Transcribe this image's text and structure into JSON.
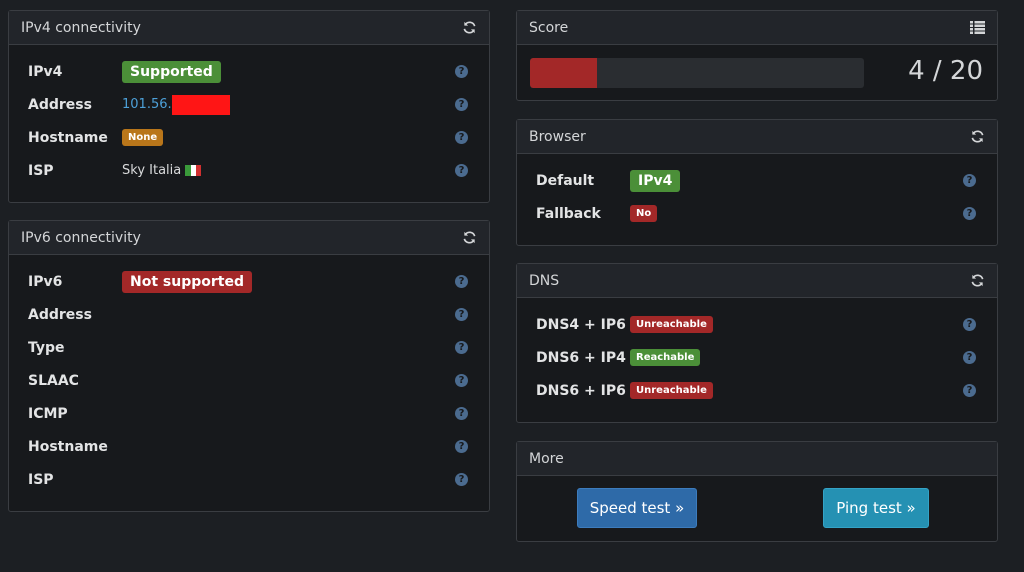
{
  "ipv4": {
    "title": "IPv4 connectivity",
    "rows": [
      {
        "label": "IPv4",
        "value": "Supported"
      },
      {
        "label": "Address",
        "value": "101.56."
      },
      {
        "label": "Hostname",
        "value": "None"
      },
      {
        "label": "ISP",
        "value": "Sky Italia"
      }
    ]
  },
  "ipv6": {
    "title": "IPv6 connectivity",
    "rows": [
      {
        "label": "IPv6",
        "value": "Not supported"
      },
      {
        "label": "Address"
      },
      {
        "label": "Type"
      },
      {
        "label": "SLAAC"
      },
      {
        "label": "ICMP"
      },
      {
        "label": "Hostname"
      },
      {
        "label": "ISP"
      }
    ]
  },
  "score": {
    "title": "Score",
    "value": 4,
    "max": 20,
    "text": "4 / 20",
    "bar_color": "#a32828"
  },
  "browser": {
    "title": "Browser",
    "rows": [
      {
        "label": "Default",
        "value": "IPv4"
      },
      {
        "label": "Fallback",
        "value": "No"
      }
    ]
  },
  "dns": {
    "title": "DNS",
    "rows": [
      {
        "label": "DNS4 + IP6",
        "value": "Unreachable"
      },
      {
        "label": "DNS6 + IP4",
        "value": "Reachable"
      },
      {
        "label": "DNS6 + IP6",
        "value": "Unreachable"
      }
    ]
  },
  "more": {
    "title": "More",
    "speed_test": "Speed test »",
    "ping_test": "Ping test »"
  },
  "help_glyph": "?",
  "icons": {
    "refresh": "refresh-icon",
    "list": "list-icon",
    "help": "help-icon",
    "flag": "italy-flag-icon"
  },
  "colors": {
    "success": "#4b8f38",
    "danger": "#a32828",
    "warning": "#b9761a",
    "link": "#4da0d8",
    "primary_btn": "#2e6aa8",
    "info_btn": "#2591b3"
  }
}
